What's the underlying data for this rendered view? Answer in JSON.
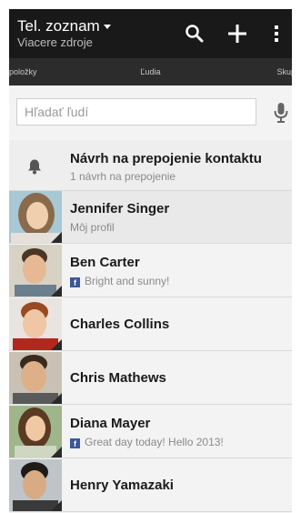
{
  "actionbar": {
    "title": "Tel. zoznam",
    "subtitle": "Viacere zdroje",
    "icons": [
      "search-icon",
      "add-icon",
      "overflow-menu-icon"
    ]
  },
  "tabs": {
    "left": "položky",
    "center": "Ľudia",
    "right": "Skupi"
  },
  "search": {
    "placeholder": "Hľadať ľudí",
    "value": ""
  },
  "suggestion": {
    "title": "Návrh na prepojenie kontaktu",
    "subtitle": "1 návrh na prepojenie",
    "icon": "bell-icon"
  },
  "contacts": [
    {
      "name": "Jennifer Singer",
      "status": "Môj profil",
      "facebook": false
    },
    {
      "name": "Ben Carter",
      "status": "Bright and sunny!",
      "facebook": true
    },
    {
      "name": "Charles Collins",
      "status": "",
      "facebook": false
    },
    {
      "name": "Chris Mathews",
      "status": "",
      "facebook": false
    },
    {
      "name": "Diana Mayer",
      "status": "Great day today! Hello 2013!",
      "facebook": true
    },
    {
      "name": "Henry Yamazaki",
      "status": "",
      "facebook": false
    }
  ],
  "colors": {
    "actionbar": "#191919",
    "tabs": "#2c2c2c",
    "list_bg": "#f3f3f3",
    "facebook": "#3b5998"
  }
}
